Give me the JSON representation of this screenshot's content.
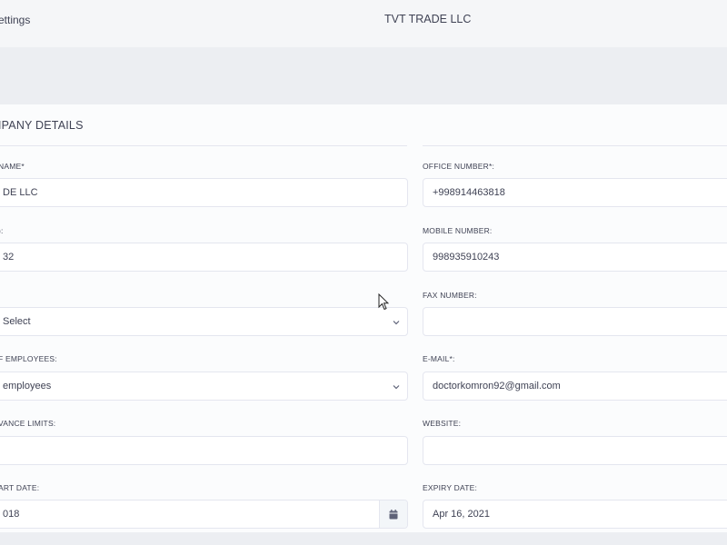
{
  "topbar": {
    "breadcrumb": "ettings",
    "company_name": "TVT TRADE LLC"
  },
  "section": {
    "title": "IPANY DETAILS"
  },
  "left_fields": [
    {
      "label": "NAME*",
      "value": "DE LLC"
    },
    {
      "label": "):",
      "value": "32"
    },
    {
      "label": "",
      "value": "Select"
    },
    {
      "label": "F EMPLOYEES:",
      "value": "employees"
    },
    {
      "label": "VANCE LIMITS:",
      "value": ""
    },
    {
      "label": "ART DATE:",
      "value": "018"
    }
  ],
  "right_fields": [
    {
      "label": "OFFICE NUMBER*:",
      "value": "+998914463818"
    },
    {
      "label": "MOBILE NUMBER:",
      "value": "998935910243"
    },
    {
      "label": "FAX NUMBER:",
      "value": ""
    },
    {
      "label": "E-MAIL*:",
      "value": "doctorkomron92@gmail.com"
    },
    {
      "label": "WEBSITE:",
      "value": ""
    },
    {
      "label": "EXPIRY DATE:",
      "value": "Apr 16, 2021"
    }
  ],
  "icons": {
    "select_chevron": "chevron-down-icon",
    "calendar": "calendar-icon",
    "cursor": "mouse-pointer"
  },
  "colors": {
    "background": "#eceef2",
    "card": "#fbfcfd",
    "border": "#e4e6ef",
    "text": "#3f4254"
  }
}
